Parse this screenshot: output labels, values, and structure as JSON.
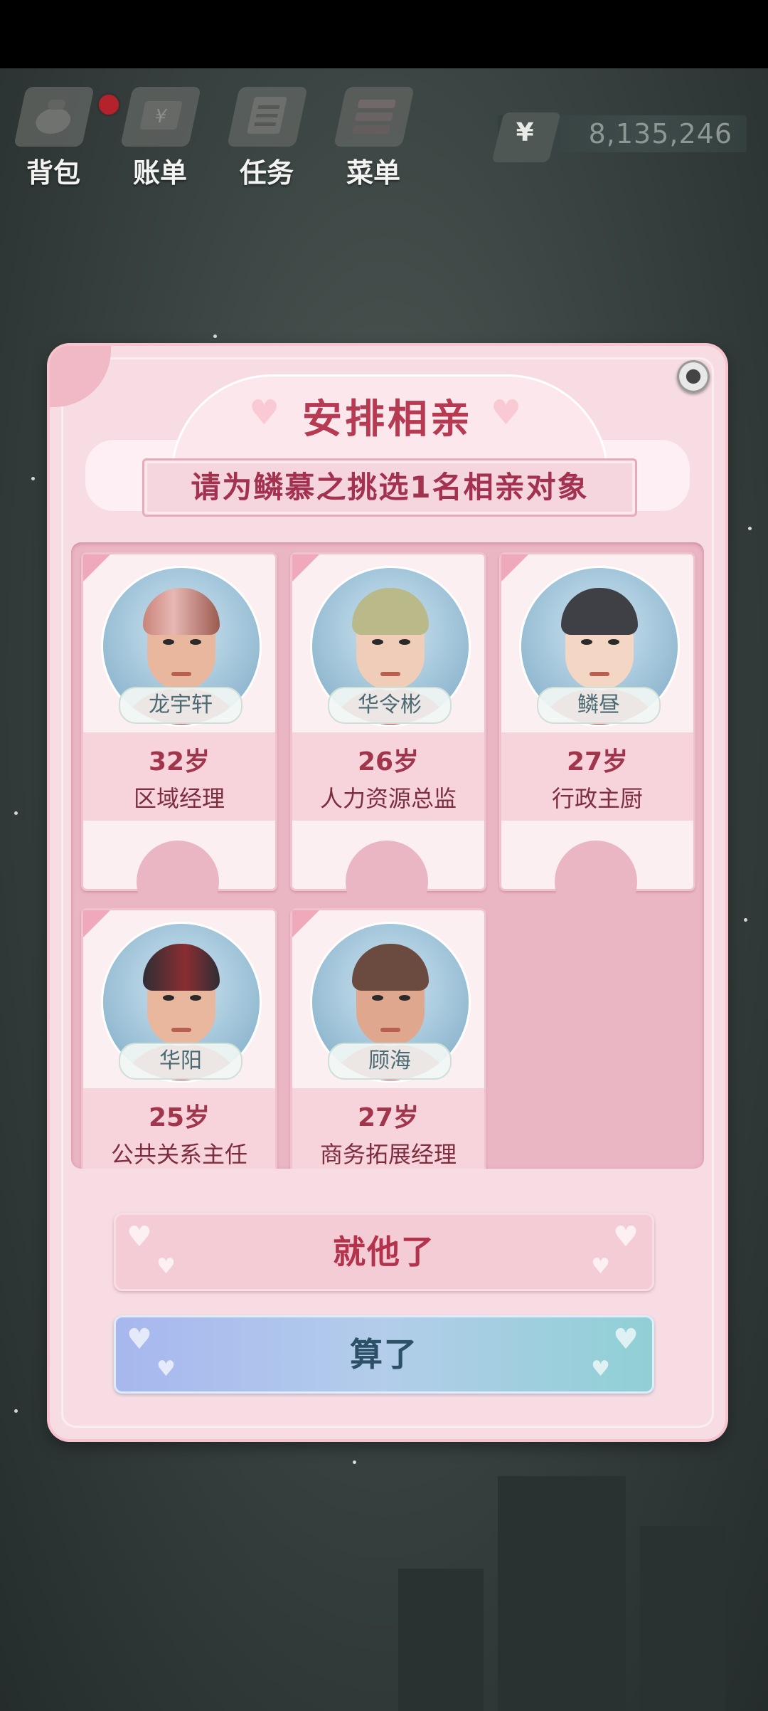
{
  "hud": {
    "items": [
      {
        "label": "背包",
        "icon": "backpack-icon"
      },
      {
        "label": "账单",
        "icon": "bill-icon"
      },
      {
        "label": "任务",
        "icon": "task-icon"
      },
      {
        "label": "菜单",
        "icon": "menu-icon"
      }
    ],
    "currency_symbol": "¥",
    "money": "8,135,246"
  },
  "dialog": {
    "title": "安排相亲",
    "subtitle": "请为鳞慕之挑选1名相亲对象",
    "candidates": [
      {
        "name": "龙宇轩",
        "age": "32岁",
        "job": "区域经理"
      },
      {
        "name": "华令彬",
        "age": "26岁",
        "job": "人力资源总监"
      },
      {
        "name": "鳞昼",
        "age": "27岁",
        "job": "行政主厨"
      },
      {
        "name": "华阳",
        "age": "25岁",
        "job": "公共关系主任"
      },
      {
        "name": "顾海",
        "age": "27岁",
        "job": "商务拓展经理"
      }
    ],
    "confirm_label": "就他了",
    "cancel_label": "算了"
  },
  "colors": {
    "accent": "#b53a52",
    "dialog_bg": "#f7dde3",
    "cancel_button": "#a7b7ef"
  }
}
